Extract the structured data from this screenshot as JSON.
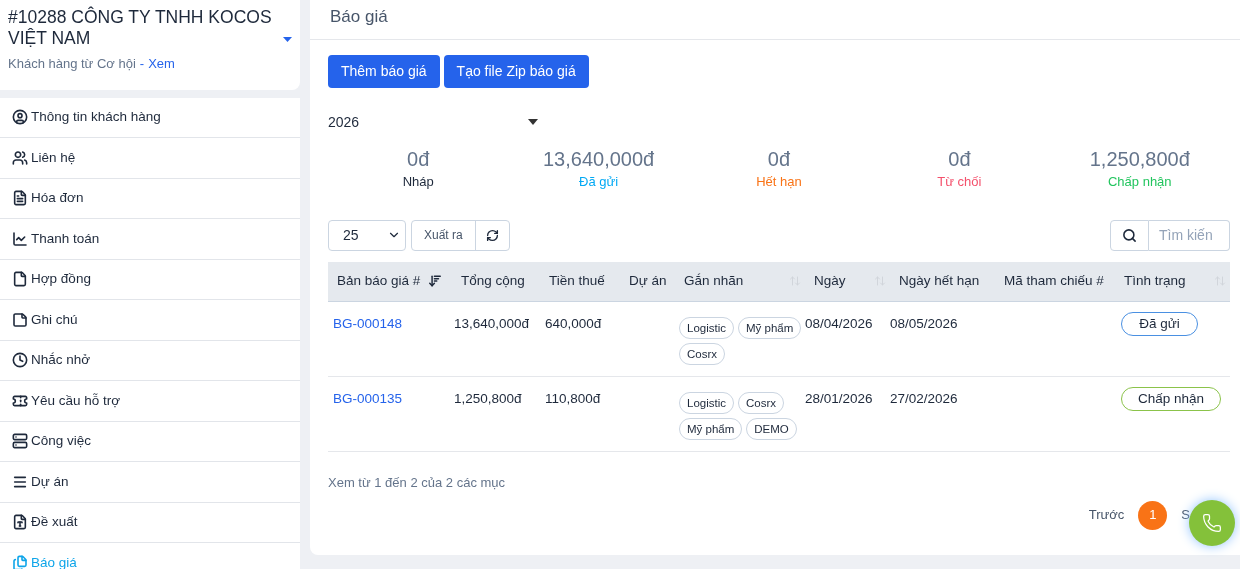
{
  "customer": {
    "title": "#10288 CÔNG TY TNHH KOCOS VIỆT NAM",
    "source": "Khách hàng từ Cơ hội",
    "separator": "-",
    "link": "Xem"
  },
  "sidebar": {
    "items": [
      {
        "label": "Thông tin khách hàng",
        "selected": false
      },
      {
        "label": "Liên hệ",
        "selected": false
      },
      {
        "label": "Hóa đơn",
        "selected": false
      },
      {
        "label": "Thanh toán",
        "selected": false
      },
      {
        "label": "Hợp đồng",
        "selected": false
      },
      {
        "label": "Ghi chú",
        "selected": false
      },
      {
        "label": "Nhắc nhở",
        "selected": false
      },
      {
        "label": "Yêu cầu hỗ trợ",
        "selected": false
      },
      {
        "label": "Công việc",
        "selected": false
      },
      {
        "label": "Dự án",
        "selected": false
      },
      {
        "label": "Đề xuất",
        "selected": false
      },
      {
        "label": "Báo giá",
        "selected": true
      }
    ]
  },
  "panel": {
    "title": "Báo giá",
    "buttons": [
      "Thêm báo giá",
      "Tạo file Zip báo giá"
    ],
    "year": {
      "value": "2026"
    },
    "stats": [
      {
        "amount": "0đ",
        "label": "Nháp",
        "color": "#1e293b"
      },
      {
        "amount": "13,640,000đ",
        "label": "Đã gửi",
        "color": "#03a9f4"
      },
      {
        "amount": "0đ",
        "label": "Hết hạn",
        "color": "#f97316"
      },
      {
        "amount": "0đ",
        "label": "Từ chối",
        "color": "#f4516c"
      },
      {
        "amount": "1,250,800đ",
        "label": "Chấp nhận",
        "color": "#22c55e"
      }
    ],
    "page_size": "25",
    "export_button": "Xuất ra",
    "search": {
      "placeholder": "Tìm kiến"
    },
    "table": {
      "columns": [
        {
          "label": "Bản báo giá #",
          "sortable": true,
          "sorted": true
        },
        {
          "label": "Tổng cộng",
          "sortable": false
        },
        {
          "label": "Tiền thuế",
          "sortable": false
        },
        {
          "label": "Dự án",
          "sortable": false
        },
        {
          "label": "Gắn nhãn",
          "sortable": true,
          "sorted": false
        },
        {
          "label": "Ngày",
          "sortable": true,
          "sorted": false
        },
        {
          "label": "Ngày hết hạn",
          "sortable": false
        },
        {
          "label": "Mã tham chiếu #",
          "sortable": false
        },
        {
          "label": "Tình trạng",
          "sortable": true,
          "sorted": false
        }
      ],
      "rows": [
        {
          "number": "BG-000148",
          "total": "13,640,000đ",
          "tax": "640,000đ",
          "tags": [
            "Logistic",
            "Mỹ phẩm",
            "Cosrx"
          ],
          "date": "08/04/2026",
          "expiry": "08/05/2026",
          "status": {
            "label": "Đã gửi",
            "color": "#4a90e2"
          }
        },
        {
          "number": "BG-000135",
          "total": "1,250,800đ",
          "tax": "110,800đ",
          "tags": [
            "Logistic",
            "Cosrx",
            "Mỹ phẩm",
            "DEMO"
          ],
          "date": "28/01/2026",
          "expiry": "27/02/2026",
          "status": {
            "label": "Chấp nhận",
            "color": "#8bc34a"
          }
        }
      ]
    },
    "summary": "Xem từ 1 đến 2 của 2 các mục",
    "pagination": {
      "previous": "Trước",
      "pages": [
        {
          "label": "1",
          "selected": true
        }
      ],
      "next": "S"
    }
  }
}
